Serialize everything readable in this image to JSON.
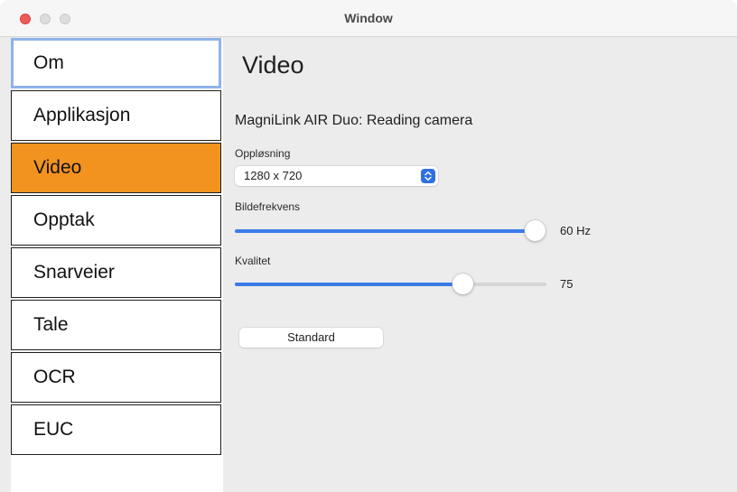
{
  "window": {
    "title": "Window"
  },
  "sidebar": {
    "items": [
      {
        "label": "Om"
      },
      {
        "label": "Applikasjon"
      },
      {
        "label": "Video"
      },
      {
        "label": "Opptak"
      },
      {
        "label": "Snarveier"
      },
      {
        "label": "Tale"
      },
      {
        "label": "OCR"
      },
      {
        "label": "EUC"
      }
    ],
    "active": "Video",
    "focused": "Om",
    "active_color": "#f29320"
  },
  "main": {
    "heading": "Video",
    "camera_name": "MagniLink AIR Duo: Reading camera",
    "resolution": {
      "label": "Oppløsning",
      "value": "1280 x 720"
    },
    "framerate": {
      "label": "Bildefrekvens",
      "value_text": "60 Hz",
      "fraction": 1.0
    },
    "quality": {
      "label": "Kvalitet",
      "value_text": "75",
      "fraction": 0.73
    },
    "default_button": "Standard"
  },
  "colors": {
    "accent": "#3a7be8",
    "close": "#ee5a56"
  }
}
